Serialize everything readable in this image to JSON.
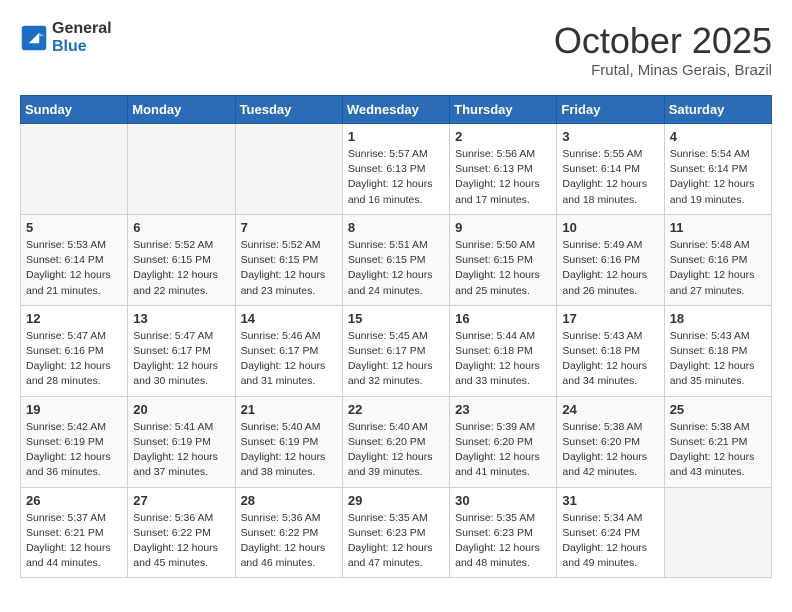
{
  "header": {
    "logo_line1": "General",
    "logo_line2": "Blue",
    "month": "October 2025",
    "location": "Frutal, Minas Gerais, Brazil"
  },
  "weekdays": [
    "Sunday",
    "Monday",
    "Tuesday",
    "Wednesday",
    "Thursday",
    "Friday",
    "Saturday"
  ],
  "weeks": [
    [
      {
        "day": "",
        "info": ""
      },
      {
        "day": "",
        "info": ""
      },
      {
        "day": "",
        "info": ""
      },
      {
        "day": "1",
        "info": "Sunrise: 5:57 AM\nSunset: 6:13 PM\nDaylight: 12 hours\nand 16 minutes."
      },
      {
        "day": "2",
        "info": "Sunrise: 5:56 AM\nSunset: 6:13 PM\nDaylight: 12 hours\nand 17 minutes."
      },
      {
        "day": "3",
        "info": "Sunrise: 5:55 AM\nSunset: 6:14 PM\nDaylight: 12 hours\nand 18 minutes."
      },
      {
        "day": "4",
        "info": "Sunrise: 5:54 AM\nSunset: 6:14 PM\nDaylight: 12 hours\nand 19 minutes."
      }
    ],
    [
      {
        "day": "5",
        "info": "Sunrise: 5:53 AM\nSunset: 6:14 PM\nDaylight: 12 hours\nand 21 minutes."
      },
      {
        "day": "6",
        "info": "Sunrise: 5:52 AM\nSunset: 6:15 PM\nDaylight: 12 hours\nand 22 minutes."
      },
      {
        "day": "7",
        "info": "Sunrise: 5:52 AM\nSunset: 6:15 PM\nDaylight: 12 hours\nand 23 minutes."
      },
      {
        "day": "8",
        "info": "Sunrise: 5:51 AM\nSunset: 6:15 PM\nDaylight: 12 hours\nand 24 minutes."
      },
      {
        "day": "9",
        "info": "Sunrise: 5:50 AM\nSunset: 6:15 PM\nDaylight: 12 hours\nand 25 minutes."
      },
      {
        "day": "10",
        "info": "Sunrise: 5:49 AM\nSunset: 6:16 PM\nDaylight: 12 hours\nand 26 minutes."
      },
      {
        "day": "11",
        "info": "Sunrise: 5:48 AM\nSunset: 6:16 PM\nDaylight: 12 hours\nand 27 minutes."
      }
    ],
    [
      {
        "day": "12",
        "info": "Sunrise: 5:47 AM\nSunset: 6:16 PM\nDaylight: 12 hours\nand 28 minutes."
      },
      {
        "day": "13",
        "info": "Sunrise: 5:47 AM\nSunset: 6:17 PM\nDaylight: 12 hours\nand 30 minutes."
      },
      {
        "day": "14",
        "info": "Sunrise: 5:46 AM\nSunset: 6:17 PM\nDaylight: 12 hours\nand 31 minutes."
      },
      {
        "day": "15",
        "info": "Sunrise: 5:45 AM\nSunset: 6:17 PM\nDaylight: 12 hours\nand 32 minutes."
      },
      {
        "day": "16",
        "info": "Sunrise: 5:44 AM\nSunset: 6:18 PM\nDaylight: 12 hours\nand 33 minutes."
      },
      {
        "day": "17",
        "info": "Sunrise: 5:43 AM\nSunset: 6:18 PM\nDaylight: 12 hours\nand 34 minutes."
      },
      {
        "day": "18",
        "info": "Sunrise: 5:43 AM\nSunset: 6:18 PM\nDaylight: 12 hours\nand 35 minutes."
      }
    ],
    [
      {
        "day": "19",
        "info": "Sunrise: 5:42 AM\nSunset: 6:19 PM\nDaylight: 12 hours\nand 36 minutes."
      },
      {
        "day": "20",
        "info": "Sunrise: 5:41 AM\nSunset: 6:19 PM\nDaylight: 12 hours\nand 37 minutes."
      },
      {
        "day": "21",
        "info": "Sunrise: 5:40 AM\nSunset: 6:19 PM\nDaylight: 12 hours\nand 38 minutes."
      },
      {
        "day": "22",
        "info": "Sunrise: 5:40 AM\nSunset: 6:20 PM\nDaylight: 12 hours\nand 39 minutes."
      },
      {
        "day": "23",
        "info": "Sunrise: 5:39 AM\nSunset: 6:20 PM\nDaylight: 12 hours\nand 41 minutes."
      },
      {
        "day": "24",
        "info": "Sunrise: 5:38 AM\nSunset: 6:20 PM\nDaylight: 12 hours\nand 42 minutes."
      },
      {
        "day": "25",
        "info": "Sunrise: 5:38 AM\nSunset: 6:21 PM\nDaylight: 12 hours\nand 43 minutes."
      }
    ],
    [
      {
        "day": "26",
        "info": "Sunrise: 5:37 AM\nSunset: 6:21 PM\nDaylight: 12 hours\nand 44 minutes."
      },
      {
        "day": "27",
        "info": "Sunrise: 5:36 AM\nSunset: 6:22 PM\nDaylight: 12 hours\nand 45 minutes."
      },
      {
        "day": "28",
        "info": "Sunrise: 5:36 AM\nSunset: 6:22 PM\nDaylight: 12 hours\nand 46 minutes."
      },
      {
        "day": "29",
        "info": "Sunrise: 5:35 AM\nSunset: 6:23 PM\nDaylight: 12 hours\nand 47 minutes."
      },
      {
        "day": "30",
        "info": "Sunrise: 5:35 AM\nSunset: 6:23 PM\nDaylight: 12 hours\nand 48 minutes."
      },
      {
        "day": "31",
        "info": "Sunrise: 5:34 AM\nSunset: 6:24 PM\nDaylight: 12 hours\nand 49 minutes."
      },
      {
        "day": "",
        "info": ""
      }
    ]
  ]
}
